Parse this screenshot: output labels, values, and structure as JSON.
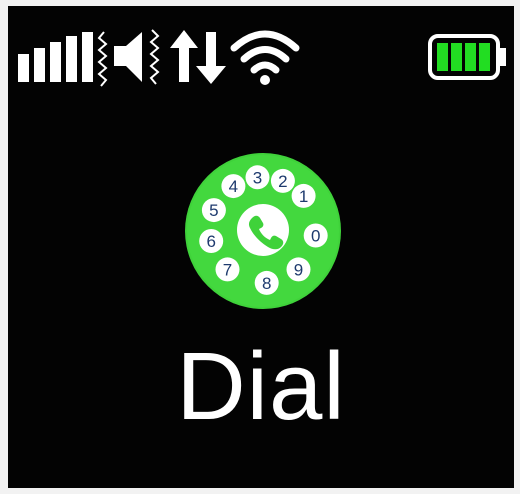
{
  "status_bar": {
    "signal_icon": "signal-strength-icon",
    "vibrate_icon": "vibrate-icon",
    "data_icon": "data-transfer-icon",
    "wifi_icon": "wifi-icon",
    "battery_icon": "battery-icon",
    "battery_level": 1.0,
    "battery_color": "#22dd22"
  },
  "main": {
    "app_icon": "rotary-dial-icon",
    "app_icon_color": "#3fd23a",
    "dial_digits": [
      "1",
      "2",
      "3",
      "4",
      "5",
      "6",
      "7",
      "8",
      "9",
      "0"
    ],
    "app_label": "Dial"
  }
}
